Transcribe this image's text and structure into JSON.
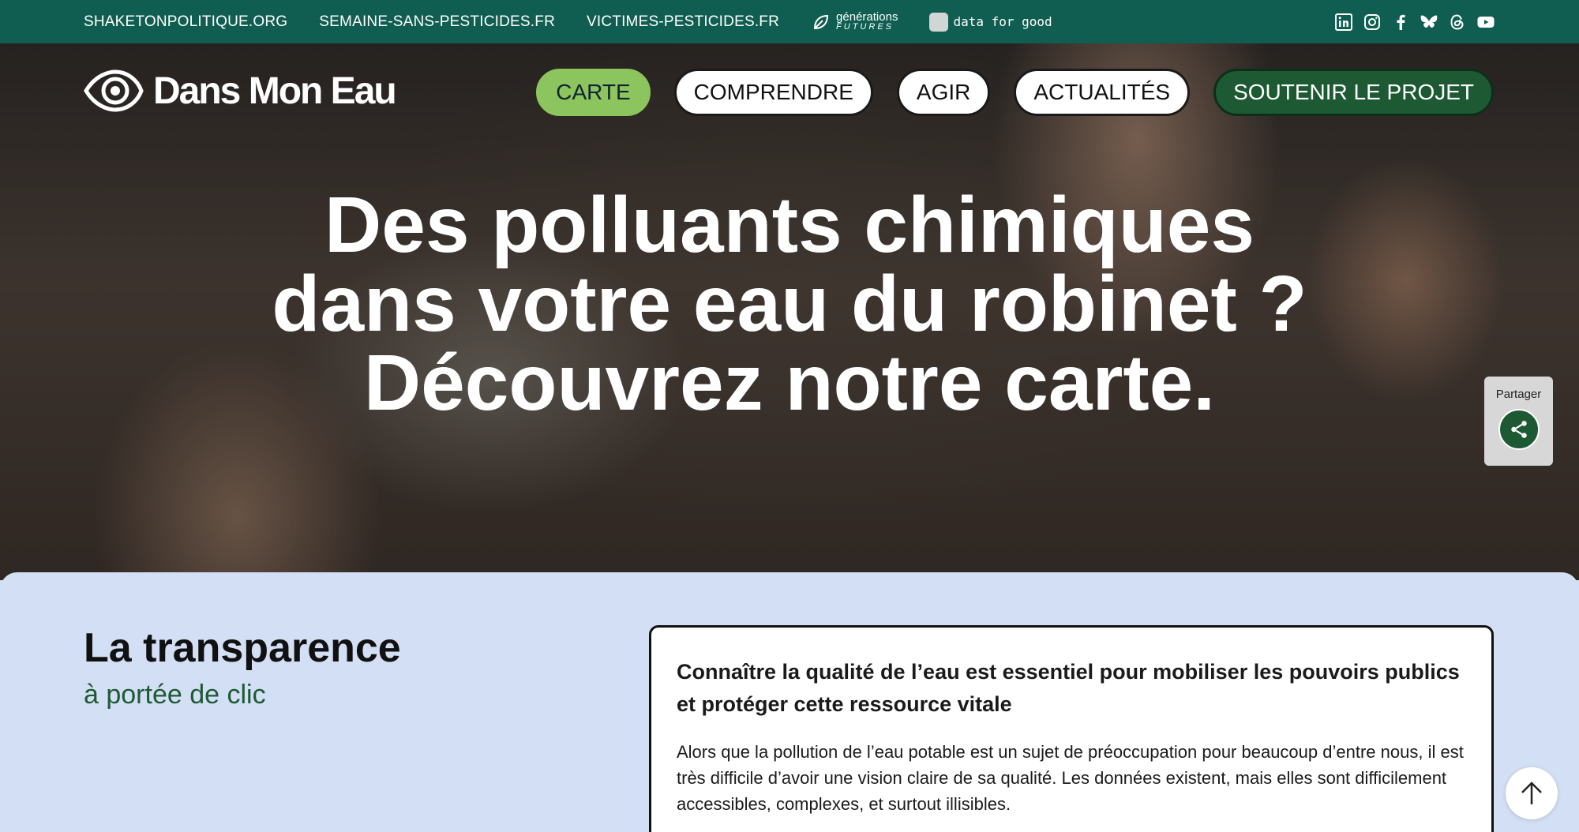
{
  "topbar": {
    "links": [
      "SHAKETONPOLITIQUE.ORG",
      "SEMAINE-SANS-PESTICIDES.FR",
      "VICTIMES-PESTICIDES.FR"
    ],
    "partner_generations": {
      "line1": "générations",
      "line2": "FUTURES"
    },
    "partner_dfg": "data for good",
    "social_icons": [
      "linkedin-icon",
      "instagram-icon",
      "facebook-icon",
      "bluesky-icon",
      "threads-icon",
      "youtube-icon"
    ]
  },
  "brand": {
    "name": "Dans Mon Eau"
  },
  "nav": {
    "carte": "CARTE",
    "comprendre": "COMPRENDRE",
    "agir": "AGIR",
    "actualites": "ACTUALITÉS",
    "soutenir": "SOUTENIR LE PROJET"
  },
  "hero": {
    "line1": "Des polluants chimiques",
    "line2": "dans votre eau du robinet ?",
    "line3": "Découvrez notre carte."
  },
  "share": {
    "label": "Partager"
  },
  "section": {
    "title": "La transparence",
    "subtitle": "à portée de clic",
    "card_title": "Connaître la qualité de l’eau est essentiel pour mobiliser les pouvoirs publics et protéger cette ressource vitale",
    "card_body": "Alors que la pollution de l’eau potable est un sujet de préoccupation pour beaucoup d’entre nous, il est très difficile d’avoir une vision claire de sa qualité. Les données existent, mais elles sont difficilement accessibles, complexes, et surtout illisibles."
  },
  "colors": {
    "topbar": "#0f5e51",
    "accent_green": "#8cc45d",
    "dark_green": "#1d5a33",
    "section_bg": "#d3dff4"
  }
}
